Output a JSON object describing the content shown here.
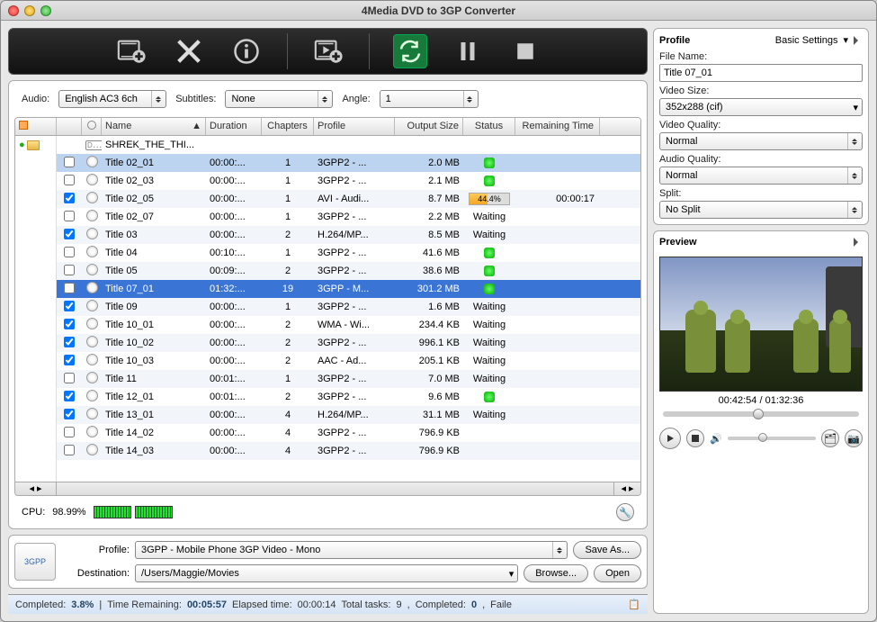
{
  "window_title": "4Media DVD to 3GP Converter",
  "toolbar": {
    "addfilm": "add-films",
    "delete": "delete",
    "info": "info",
    "addclip": "add-clip",
    "refresh": "refresh",
    "pause": "pause",
    "stop": "stop"
  },
  "selectors": {
    "audio_label": "Audio:",
    "audio_value": "English AC3 6ch",
    "subtitles_label": "Subtitles:",
    "subtitles_value": "None",
    "angle_label": "Angle:",
    "angle_value": "1"
  },
  "columns": {
    "chk": "",
    "disc": "",
    "name": "Name",
    "duration": "Duration",
    "chapters": "Chapters",
    "profile": "Profile",
    "size": "Output Size",
    "status": "Status",
    "remaining": "Remaining Time"
  },
  "root_name": "SHREK_THE_THI...",
  "rows": [
    {
      "chk": false,
      "name": "Title 02_01",
      "dur": "00:00:...",
      "chap": "1",
      "prof": "3GPP2 - ...",
      "size": "2.0 MB",
      "status": "dot",
      "hilite": true
    },
    {
      "chk": false,
      "name": "Title 02_03",
      "dur": "00:00:...",
      "chap": "1",
      "prof": "3GPP2 - ...",
      "size": "2.1 MB",
      "status": "dot"
    },
    {
      "chk": true,
      "name": "Title 02_05",
      "dur": "00:00:...",
      "chap": "1",
      "prof": "AVI - Audi...",
      "size": "8.7 MB",
      "status": "progress",
      "progress": "44.4%",
      "rem": "00:00:17"
    },
    {
      "chk": false,
      "name": "Title 02_07",
      "dur": "00:00:...",
      "chap": "1",
      "prof": "3GPP2 - ...",
      "size": "2.2 MB",
      "status": "Waiting"
    },
    {
      "chk": true,
      "name": "Title 03",
      "dur": "00:00:...",
      "chap": "2",
      "prof": "H.264/MP...",
      "size": "8.5 MB",
      "status": "Waiting"
    },
    {
      "chk": false,
      "name": "Title 04",
      "dur": "00:10:...",
      "chap": "1",
      "prof": "3GPP2 - ...",
      "size": "41.6 MB",
      "status": "dot"
    },
    {
      "chk": false,
      "name": "Title 05",
      "dur": "00:09:...",
      "chap": "2",
      "prof": "3GPP2 - ...",
      "size": "38.6 MB",
      "status": "dot"
    },
    {
      "chk": false,
      "name": "Title 07_01",
      "dur": "01:32:...",
      "chap": "19",
      "prof": "3GPP - M...",
      "size": "301.2 MB",
      "status": "dot",
      "sel": true
    },
    {
      "chk": true,
      "name": "Title 09",
      "dur": "00:00:...",
      "chap": "1",
      "prof": "3GPP2 - ...",
      "size": "1.6 MB",
      "status": "Waiting"
    },
    {
      "chk": true,
      "name": "Title 10_01",
      "dur": "00:00:...",
      "chap": "2",
      "prof": "WMA - Wi...",
      "size": "234.4 KB",
      "status": "Waiting"
    },
    {
      "chk": true,
      "name": "Title 10_02",
      "dur": "00:00:...",
      "chap": "2",
      "prof": "3GPP2 - ...",
      "size": "996.1 KB",
      "status": "Waiting"
    },
    {
      "chk": true,
      "name": "Title 10_03",
      "dur": "00:00:...",
      "chap": "2",
      "prof": "AAC - Ad...",
      "size": "205.1 KB",
      "status": "Waiting"
    },
    {
      "chk": false,
      "name": "Title 11",
      "dur": "00:01:...",
      "chap": "1",
      "prof": "3GPP2 - ...",
      "size": "7.0 MB",
      "status": "Waiting"
    },
    {
      "chk": true,
      "name": "Title 12_01",
      "dur": "00:01:...",
      "chap": "2",
      "prof": "3GPP2 - ...",
      "size": "9.6 MB",
      "status": "dot"
    },
    {
      "chk": true,
      "name": "Title 13_01",
      "dur": "00:00:...",
      "chap": "4",
      "prof": "H.264/MP...",
      "size": "31.1 MB",
      "status": "Waiting"
    },
    {
      "chk": false,
      "name": "Title 14_02",
      "dur": "00:00:...",
      "chap": "4",
      "prof": "3GPP2 - ...",
      "size": "796.9 KB",
      "status": ""
    },
    {
      "chk": false,
      "name": "Title 14_03",
      "dur": "00:00:...",
      "chap": "4",
      "prof": "3GPP2 - ...",
      "size": "796.9 KB",
      "status": ""
    }
  ],
  "cpu_label": "CPU:",
  "cpu_value": "98.99%",
  "profile_section": {
    "icon": "3GPP",
    "profile_label": "Profile:",
    "profile_value": "3GPP - Mobile Phone 3GP Video - Mono",
    "saveas": "Save As...",
    "dest_label": "Destination:",
    "dest_value": "/Users/Maggie/Movies",
    "browse": "Browse...",
    "open": "Open"
  },
  "status": {
    "completed_label": "Completed:",
    "completed_val": "3.8%",
    "remain_label": "Time Remaining:",
    "remain_val": "00:05:57",
    "elapsed_label": "Elapsed time:",
    "elapsed_val": "00:00:14",
    "total_label": "Total tasks:",
    "total_val": "9",
    "done_label": "Completed:",
    "done_val": "0",
    "fail_label": "Faile"
  },
  "right": {
    "profile_title": "Profile",
    "basic": "Basic Settings",
    "filename_label": "File Name:",
    "filename_value": "Title 07_01",
    "videosize_label": "Video Size:",
    "videosize_value": "352x288 (cif)",
    "vq_label": "Video Quality:",
    "vq_value": "Normal",
    "aq_label": "Audio Quality:",
    "aq_value": "Normal",
    "split_label": "Split:",
    "split_value": "No Split",
    "preview_title": "Preview",
    "time": "00:42:54 / 01:32:36"
  }
}
